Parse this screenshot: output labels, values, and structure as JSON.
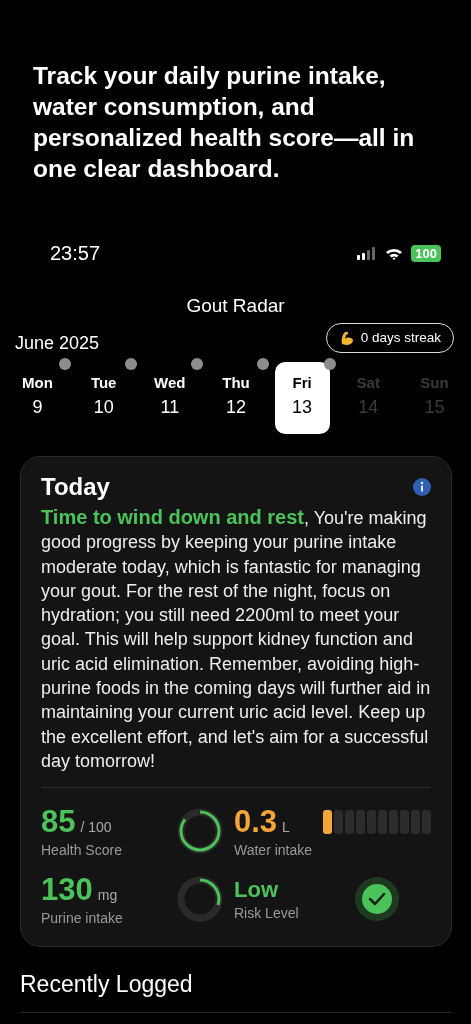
{
  "promo": "Track your daily purine intake, water consumption, and personalized health score—all in one clear dashboard.",
  "status_bar": {
    "time": "23:57",
    "battery": "100"
  },
  "title": "Gout Radar",
  "month": "June 2025",
  "streak": "0 days streak",
  "days": [
    {
      "weekday": "Mon",
      "date": "9",
      "logged": true,
      "selected": false,
      "disabled": false
    },
    {
      "weekday": "Tue",
      "date": "10",
      "logged": true,
      "selected": false,
      "disabled": false
    },
    {
      "weekday": "Wed",
      "date": "11",
      "logged": true,
      "selected": false,
      "disabled": false
    },
    {
      "weekday": "Thu",
      "date": "12",
      "logged": true,
      "selected": false,
      "disabled": false
    },
    {
      "weekday": "Fri",
      "date": "13",
      "logged": true,
      "selected": true,
      "disabled": false
    },
    {
      "weekday": "Sat",
      "date": "14",
      "logged": false,
      "selected": false,
      "disabled": true
    },
    {
      "weekday": "Sun",
      "date": "15",
      "logged": false,
      "selected": false,
      "disabled": true
    }
  ],
  "today": {
    "title": "Today",
    "headline": "Time to wind down and rest",
    "message": ", You're making good progress by keeping your purine intake moderate today, which is fantastic for managing your gout. For the rest of the night, focus on hydration; you still need 2200ml to meet your goal. This will help support kidney function and uric acid elimination. Remember, avoiding high-purine foods in the coming days will further aid in maintaining your current uric acid level. Keep up the excellent effort, and let's aim for a successful day tomorrow!"
  },
  "metrics": {
    "health_score": {
      "value": "85",
      "unit": "/ 100",
      "label": "Health Score"
    },
    "water": {
      "value": "0.3",
      "unit": "L",
      "label": "Water intake",
      "level": 0.1
    },
    "purine": {
      "value": "130",
      "unit": "mg",
      "label": "Purine intake"
    },
    "risk": {
      "value": "Low",
      "label": "Risk Level",
      "checked": true
    }
  },
  "section_title": "Recently Logged"
}
